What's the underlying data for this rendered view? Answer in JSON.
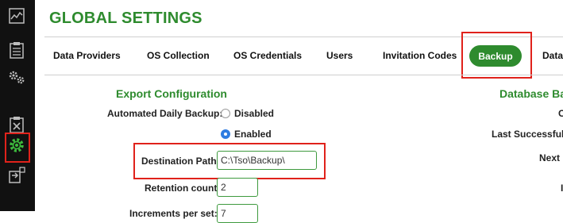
{
  "page": {
    "title": "GLOBAL SETTINGS"
  },
  "tabs": [
    {
      "label": "Data Providers"
    },
    {
      "label": "OS Collection"
    },
    {
      "label": "OS Credentials"
    },
    {
      "label": "Users"
    },
    {
      "label": "Invitation Codes"
    },
    {
      "label": "Backup",
      "active": true
    },
    {
      "label": "Data"
    }
  ],
  "export": {
    "title": "Export Configuration",
    "daily_backup_label": "Automated Daily Backup:",
    "option_disabled": "Disabled",
    "option_enabled": "Enabled",
    "selected": "Enabled",
    "destination_label": "Destination Path:",
    "destination_value": "C:\\Tso\\Backup\\",
    "retention_label": "Retention count:",
    "retention_value": "2",
    "increments_label": "Increments per set:",
    "increments_value": "7"
  },
  "database": {
    "title": "Database Bac",
    "row1": "C",
    "last_successful_label": "Last Successful E",
    "next_label": "Next I",
    "row4": "I"
  },
  "sidebar": {
    "icons": [
      "chart-icon",
      "clipboard-icon",
      "gears-icon",
      "clipboard-x-icon",
      "settings-gear-icon",
      "export-icon"
    ],
    "active": "settings-gear-icon"
  },
  "colors": {
    "accent": "#2e8b2e",
    "highlight": "#e0221b",
    "sidebar": "#111111",
    "radio_selected": "#2f7de1"
  }
}
